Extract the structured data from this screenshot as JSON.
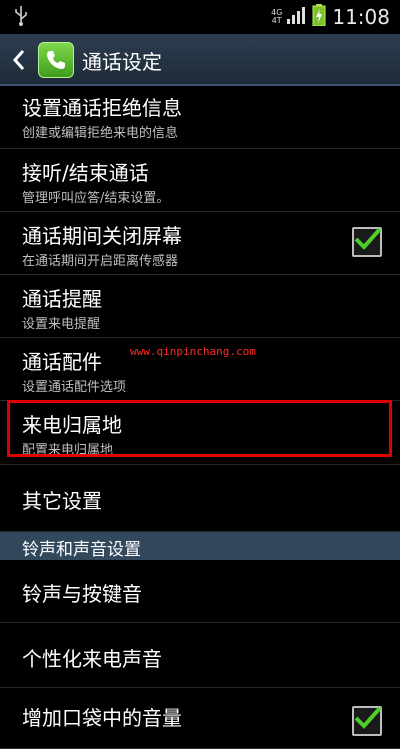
{
  "status_bar": {
    "network": "4G",
    "network_sub": "4T",
    "time": "11:08",
    "icons": [
      "usb-icon",
      "signal-icon",
      "battery-charging-icon"
    ]
  },
  "action_bar": {
    "title": "通话设定",
    "back_icon": "chevron-left-icon",
    "app_icon": "phone-icon"
  },
  "items": [
    {
      "title": "设置通话拒绝信息",
      "subtitle": "创建或编辑拒绝来电的信息"
    },
    {
      "title": "接听/结束通话",
      "subtitle": "管理呼叫应答/结束设置。"
    },
    {
      "title": "通话期间关闭屏幕",
      "subtitle": "在通话期间开启距离传感器",
      "checked": true
    },
    {
      "title": "通话提醒",
      "subtitle": "设置来电提醒"
    },
    {
      "title": "通话配件",
      "subtitle": "设置通话配件选项"
    },
    {
      "title": "来电归属地",
      "subtitle": "配置来电归属地"
    },
    {
      "title": "其它设置"
    }
  ],
  "section": {
    "label": "铃声和声音设置"
  },
  "sound_items": [
    {
      "title": "铃声与按键音"
    },
    {
      "title": "个性化来电声音"
    },
    {
      "title": "增加口袋中的音量",
      "checked": true
    }
  ],
  "watermark": "www.qinpinchang.com",
  "colors": {
    "background": "#000000",
    "action_bar": "#2d3e50",
    "section_header": "#32485c",
    "highlight_border": "#e00000",
    "check_green": "#4ccf2a"
  }
}
